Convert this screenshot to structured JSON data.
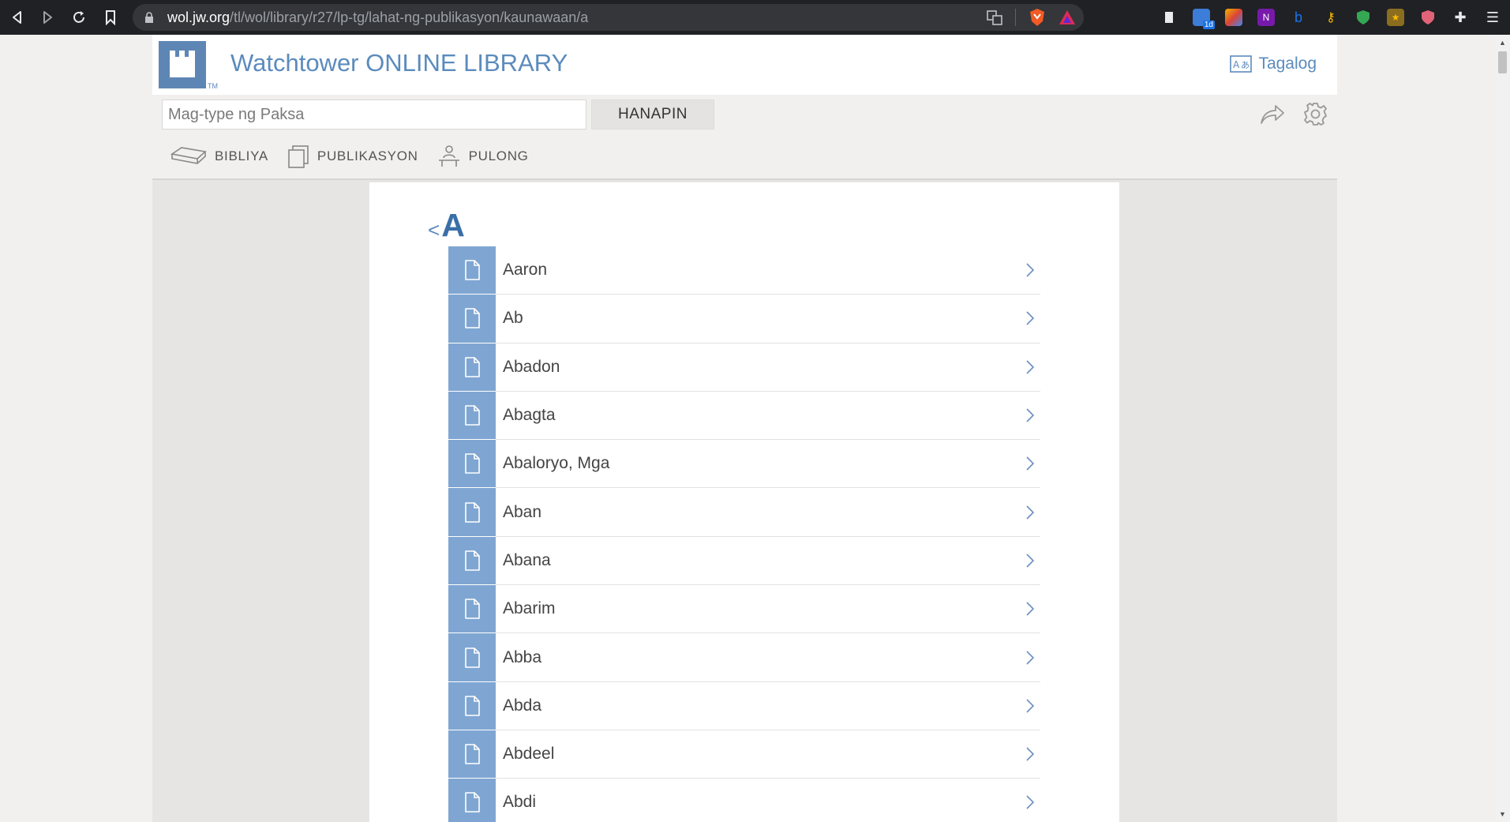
{
  "browser": {
    "url_domain": "wol.jw.org",
    "url_path": "/tl/wol/library/r27/lp-tg/lahat-ng-publikasyon/kaunawaan/a",
    "extension_badge": "1d"
  },
  "header": {
    "site_title": "Watchtower ONLINE LIBRARY",
    "trademark": "TM",
    "language_label": "Tagalog"
  },
  "search": {
    "placeholder": "Mag-type ng Paksa",
    "button_label": "HANAPIN"
  },
  "nav": {
    "items": [
      {
        "label": "BIBLIYA",
        "icon": "bible-icon"
      },
      {
        "label": "PUBLIKASYON",
        "icon": "publications-icon"
      },
      {
        "label": "PULONG",
        "icon": "meetings-icon"
      }
    ]
  },
  "page": {
    "letter": "A",
    "back_chevron": "<"
  },
  "topics": [
    "Aaron",
    "Ab",
    "Abadon",
    "Abagta",
    "Abaloryo, Mga",
    "Aban",
    "Abana",
    "Abarim",
    "Abba",
    "Abda",
    "Abdeel",
    "Abdi"
  ],
  "colors": {
    "brand_blue": "#5b8bbd",
    "tile_blue": "#7fa6d2",
    "heading_blue": "#3a6fa8"
  }
}
